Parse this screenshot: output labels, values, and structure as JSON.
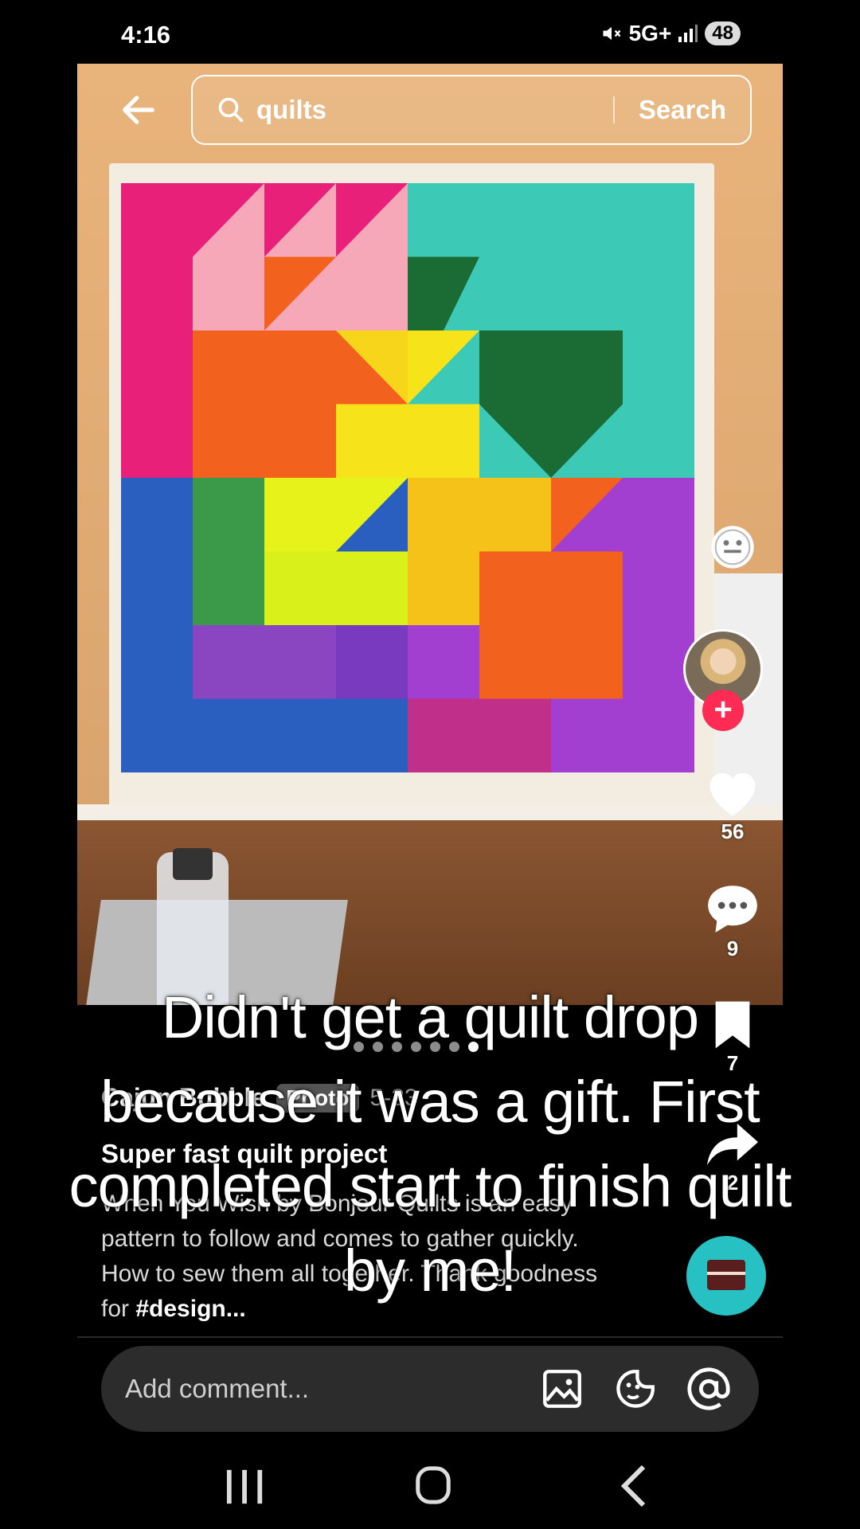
{
  "status_bar": {
    "time": "4:16",
    "network": "5G+",
    "battery": "48"
  },
  "search": {
    "query": "quilts",
    "button_label": "Search"
  },
  "rail": {
    "likes": "56",
    "comments": "9",
    "saves": "7",
    "shares": "2"
  },
  "post": {
    "author": "Cajun Bubble",
    "badge": "Photo",
    "date": "5-23",
    "title": "Super fast quilt project",
    "description": "When You Wish by Bonjour Quilts is an easy pattern to follow and comes to gather quickly. How to sew them all together. Thank goodness for ",
    "hashtag": "#design..."
  },
  "overlay_text": "Didn't get a quilt drop because it was a gift. First completed start to finish quilt by me!",
  "carousel": {
    "total": 7,
    "active": 7
  },
  "comment": {
    "placeholder": "Add comment..."
  },
  "icons": {
    "back": "arrow-left-icon",
    "search": "search-icon",
    "emoji": "face-icon",
    "like": "heart-icon",
    "comment": "speech-bubble-icon",
    "save": "bookmark-icon",
    "share": "share-arrow-icon",
    "image": "image-icon",
    "sticker": "emoji-sticker-icon",
    "mention": "at-icon"
  },
  "colors": {
    "accent": "#fe2c55",
    "disc": "#27c1c4"
  }
}
